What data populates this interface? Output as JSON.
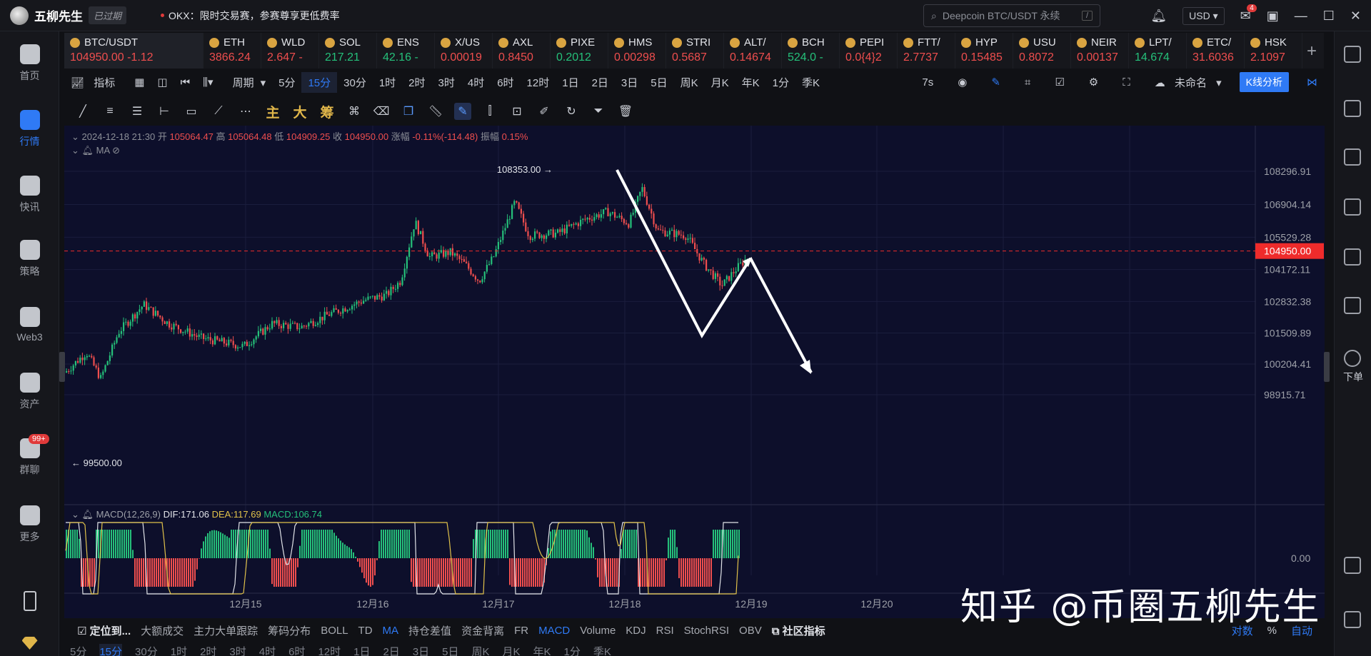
{
  "app": {
    "name": "五柳先生",
    "status": "已过期",
    "notice": "OKX：限时交易赛，参赛尊享更低费率"
  },
  "search": {
    "placeholder": "Deepcoin BTC/USDT 永续",
    "shortcut": "/"
  },
  "header": {
    "currency": "USD",
    "mail_badge": "4"
  },
  "leftnav": [
    {
      "label": "首页",
      "icon": "home-icon"
    },
    {
      "label": "行情",
      "icon": "market-icon",
      "active": true
    },
    {
      "label": "快讯",
      "icon": "news-icon"
    },
    {
      "label": "策略",
      "icon": "strategy-icon"
    },
    {
      "label": "Web3",
      "icon": "web3-icon"
    },
    {
      "label": "资产",
      "icon": "wallet-icon"
    },
    {
      "label": "群聊",
      "icon": "chat-icon",
      "badge": "99+"
    },
    {
      "label": "更多",
      "icon": "more-icon"
    }
  ],
  "rightnav": {
    "order_label": "下单"
  },
  "tickers": [
    {
      "sym": "BTC/USDT",
      "price": "104950.00",
      "chg": "-1.12",
      "color": "red"
    },
    {
      "sym": "ETH",
      "price": "3866.24",
      "chg": "",
      "color": "red"
    },
    {
      "sym": "WLD",
      "price": "2.647 -",
      "chg": "",
      "color": "red"
    },
    {
      "sym": "SOL",
      "price": "217.21",
      "chg": "",
      "color": "green"
    },
    {
      "sym": "ENS",
      "price": "42.16 -",
      "chg": "",
      "color": "green"
    },
    {
      "sym": "X/US",
      "price": "0.00019",
      "chg": "",
      "color": "red"
    },
    {
      "sym": "AXL",
      "price": "0.8450",
      "chg": "",
      "color": "red"
    },
    {
      "sym": "PIXE",
      "price": "0.2012",
      "chg": "",
      "color": "green"
    },
    {
      "sym": "HMS",
      "price": "0.00298",
      "chg": "",
      "color": "red"
    },
    {
      "sym": "STRI",
      "price": "0.5687",
      "chg": "",
      "color": "red"
    },
    {
      "sym": "ALT/",
      "price": "0.14674",
      "chg": "",
      "color": "red"
    },
    {
      "sym": "BCH",
      "price": "524.0 -",
      "chg": "",
      "color": "green"
    },
    {
      "sym": "PEPI",
      "price": "0.0{4}2",
      "chg": "",
      "color": "red"
    },
    {
      "sym": "FTT/",
      "price": "2.7737",
      "chg": "",
      "color": "red"
    },
    {
      "sym": "HYP",
      "price": "0.15485",
      "chg": "",
      "color": "red"
    },
    {
      "sym": "USU",
      "price": "0.8072",
      "chg": "",
      "color": "red"
    },
    {
      "sym": "NEIR",
      "price": "0.00137",
      "chg": "",
      "color": "red"
    },
    {
      "sym": "LPT/",
      "price": "14.674",
      "chg": "",
      "color": "green"
    },
    {
      "sym": "ETC/",
      "price": "31.6036",
      "chg": "",
      "color": "red"
    },
    {
      "sym": "HSK",
      "price": "2.1097",
      "chg": "",
      "color": "red"
    }
  ],
  "toolbar1": {
    "indicator": "指标",
    "period": "周期",
    "intervals": [
      "5分",
      "15分",
      "30分",
      "1时",
      "2时",
      "3时",
      "4时",
      "6时",
      "12时",
      "1日",
      "2日",
      "3日",
      "5日",
      "周K",
      "月K",
      "年K",
      "1分",
      "季K"
    ],
    "selected": "15分",
    "countdown": "7s",
    "layout_name": "未命名",
    "kline_analysis": "K线分析"
  },
  "toolbar2": {
    "main": "主",
    "big": "大",
    "chip": "筹"
  },
  "info": {
    "time": "2024-12-18 21:30",
    "open_label": "开",
    "open": "105064.47",
    "high_label": "高",
    "high": "105064.48",
    "low_label": "低",
    "low": "104909.25",
    "close_label": "收",
    "close": "104950.00",
    "chg_label": "涨幅",
    "chg": "-0.11%(-114.48)",
    "amp_label": "振幅",
    "amp": "0.15%",
    "ma": "MA"
  },
  "macd_info": {
    "label": "MACD(12,26,9)",
    "dif": "DIF:171.06",
    "dea": "DEA:117.69",
    "macd": "MACD:106.74"
  },
  "chart_data": {
    "type": "candlestick",
    "symbol": "BTC/USDT",
    "interval": "15分",
    "y_ticks": [
      "108296.91",
      "106904.14",
      "105529.28",
      "104172.11",
      "102832.38",
      "101509.89",
      "100204.41",
      "98915.71"
    ],
    "x_ticks": [
      "12月15",
      "12月16",
      "12月17",
      "12月18",
      "12月19",
      "12月20"
    ],
    "last_price": "104950.00",
    "high_label": "108353.00",
    "low_label": "99500.00",
    "macd_zero": "0.00",
    "colors": {
      "up": "#25c07a",
      "down": "#ef4e4e",
      "last": "#ef2b2b",
      "bg": "#0d0f2b"
    }
  },
  "watermark": "知乎 @币圈五柳先生",
  "bottombar": {
    "locate": "定位到...",
    "items": [
      "大额成交",
      "主力大单跟踪",
      "筹码分布",
      "BOLL",
      "TD",
      "MA",
      "持仓差值",
      "资金背离",
      "FR",
      "MACD",
      "Volume",
      "KDJ",
      "RSI",
      "StochRSI",
      "OBV"
    ],
    "community": "社区指标",
    "log": "对数",
    "pct": "%",
    "auto": "自动"
  },
  "bottombar2": [
    "5分",
    "15分",
    "30分",
    "1时",
    "2时",
    "3时",
    "4时",
    "6时",
    "12时",
    "1日",
    "2日",
    "3日",
    "5日",
    "周K",
    "月K",
    "年K",
    "1分",
    "季K"
  ]
}
